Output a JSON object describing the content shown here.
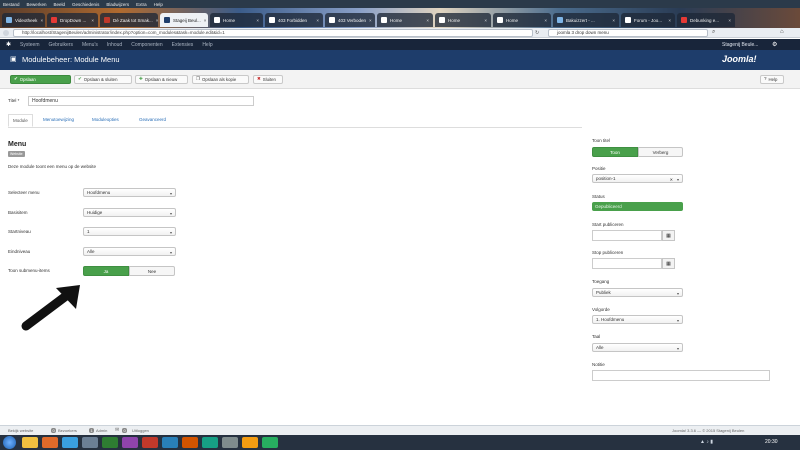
{
  "browser": {
    "menu": [
      "Bestand",
      "Bewerken",
      "Beeld",
      "Geschiedenis",
      "Bladwijzers",
      "Extra",
      "Help"
    ],
    "tabs": [
      {
        "label": "Videotheek",
        "color": "#7fb5e6"
      },
      {
        "label": "DropDown ...",
        "color": "#e53935"
      },
      {
        "label": "Dé Zaak tot Smak...",
        "color": "#c0392b"
      },
      {
        "label": "Stageij Beul...",
        "color": "#1e3d6b"
      },
      {
        "label": "Home",
        "color": "#ffffff"
      },
      {
        "label": "403 Forbidden",
        "color": "#ffffff"
      },
      {
        "label": "403 Verboden",
        "color": "#ffffff"
      },
      {
        "label": "Home",
        "color": "#ffffff"
      },
      {
        "label": "Home",
        "color": "#ffffff"
      },
      {
        "label": "Home",
        "color": "#ffffff"
      },
      {
        "label": "Bakuizzert - ...",
        "color": "#7fb5e6"
      },
      {
        "label": "Forum - Joo...",
        "color": "#ffffff"
      },
      {
        "label": "Debunking e...",
        "color": "#e53935"
      }
    ],
    "url": "http://localhost/StagenijBeulen/administrator/index.php?option=com_modules&task=module.edit&id=1",
    "search": "joomla 3 drop down menu"
  },
  "joomla": {
    "topnav": [
      "Systeem",
      "Gebruikers",
      "Menu's",
      "Inhoud",
      "Componenten",
      "Extensies",
      "Help"
    ],
    "user": "Stagenij Beule...",
    "page_title": "Modulebeheer: Module Menu",
    "logo": "Joomla!",
    "toolbar": {
      "save": "Opslaan",
      "save_close": "Opslaan & sluiten",
      "save_new": "Opslaan & nieuw",
      "save_copy": "Opslaan als kopie",
      "close": "Sluiten",
      "help": "Help"
    },
    "title_label": "Titel *",
    "title_value": "Hoofdmenu",
    "tabs": [
      "Module",
      "Menutoewijzing",
      "Moduleopties",
      "Geavanceerd"
    ],
    "module": {
      "heading": "Menu",
      "badge": "Website",
      "description": "Deze module toont een menu op de website",
      "fields": [
        {
          "label": "Selecteer menu",
          "value": "Hoofdmenu"
        },
        {
          "label": "Basisitem",
          "value": "Huidige"
        },
        {
          "label": "Startniveau",
          "value": "1"
        },
        {
          "label": "Eindniveau",
          "value": "Alle"
        }
      ],
      "submenu_label": "Toon submenu-items",
      "submenu_yes": "Ja",
      "submenu_no": "Nee"
    },
    "sidebar": {
      "show_title_label": "Toon titel",
      "show_title_on": "Toon",
      "show_title_off": "Verberg",
      "position_label": "Positie",
      "position_value": "position-1",
      "status_label": "Status",
      "status_value": "Gepubliceerd",
      "start_label": "Start publiceren",
      "stop_label": "Stop publiceren",
      "access_label": "Toegang",
      "access_value": "Publiek",
      "order_label": "Volgorde",
      "order_value": "1. Hoofdmenu",
      "language_label": "Taal",
      "language_value": "Alle",
      "note_label": "Notitie"
    },
    "footer": {
      "view_site": "Bekijk website",
      "visitors_count": "0",
      "visitors_label": "Bezoekers",
      "admins_count": "1",
      "admins_label": "Admin",
      "messages_count": "0",
      "logout": "Uitloggen",
      "copyright": "Joomla! 3.3.6 — © 2015 Stagenij Beulen"
    }
  },
  "taskbar": {
    "time": "20:30"
  }
}
